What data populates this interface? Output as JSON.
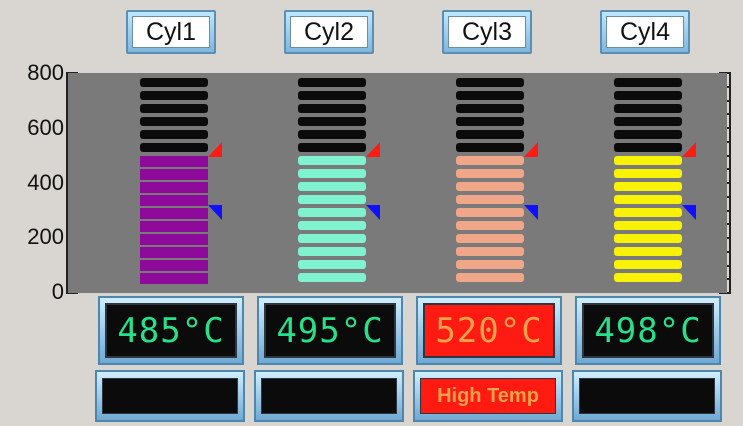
{
  "colors": {
    "background": "#d9d6d2",
    "plot_background": "#7a7a7a",
    "unfilled_segment": "#0b0b0b",
    "readout_background": "#0b0b0b",
    "readout_text": "#26e08a",
    "alarm_background": "#ff1a12",
    "alarm_text": "#f3a24c",
    "high_marker": "#ff1a12",
    "low_marker": "#1010ff"
  },
  "axis": {
    "ticks": [
      "800",
      "600",
      "400",
      "200",
      "0"
    ],
    "min": 0,
    "max": 800
  },
  "thresholds": {
    "high": 520,
    "low": 300
  },
  "cylinders": [
    {
      "label": "Cyl1",
      "temperature": 485,
      "temp_text": "485°C",
      "status": "",
      "alarm": false,
      "fill_color": "#8e0a9b",
      "fill_style": "striped"
    },
    {
      "label": "Cyl2",
      "temperature": 495,
      "temp_text": "495°C",
      "status": "",
      "alarm": false,
      "fill_color": "#7ff2cf",
      "fill_style": "segmented"
    },
    {
      "label": "Cyl3",
      "temperature": 520,
      "temp_text": "520°C",
      "status": "High Temp",
      "alarm": true,
      "fill_color": "#f0a688",
      "fill_style": "segmented"
    },
    {
      "label": "Cyl4",
      "temperature": 498,
      "temp_text": "498°C",
      "status": "",
      "alarm": false,
      "fill_color": "#f8f207",
      "fill_style": "segmented"
    }
  ]
}
